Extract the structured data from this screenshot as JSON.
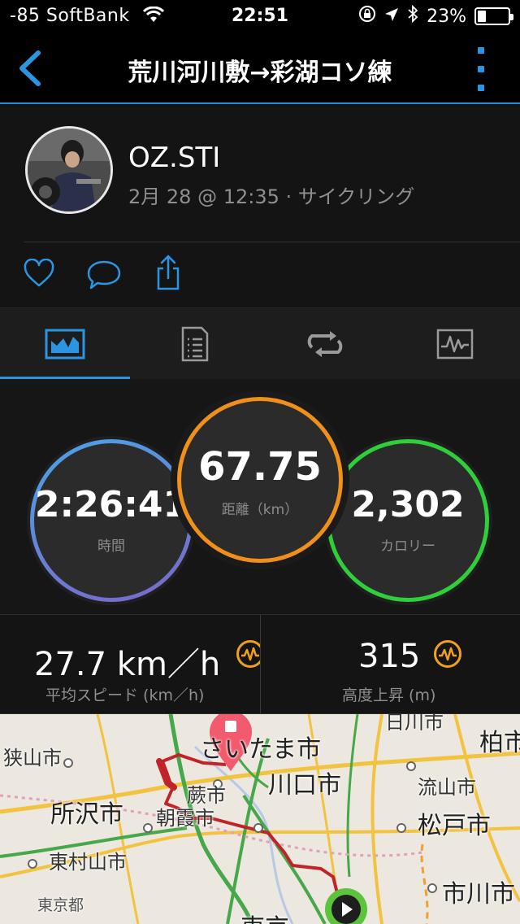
{
  "status": {
    "carrier": "-85 SoftBank",
    "time": "22:51",
    "battery": "23%"
  },
  "nav": {
    "title": "荒川河川敷→彩湖コソ練"
  },
  "profile": {
    "name": "OZ.STI",
    "meta": "2月 28 @ 12:35 · サイクリング"
  },
  "tabs": [
    {
      "icon": "overview-icon",
      "active": true
    },
    {
      "icon": "details-icon",
      "active": false
    },
    {
      "icon": "laps-icon",
      "active": false
    },
    {
      "icon": "charts-icon",
      "active": false
    }
  ],
  "stats": {
    "time": {
      "value": "2:26:41",
      "label": "時間"
    },
    "distance": {
      "value": "67.75",
      "label": "距離（km）"
    },
    "calories": {
      "value": "2,302",
      "label": "カロリー"
    }
  },
  "detail": {
    "speed": {
      "value": "27.7 km／h",
      "label": "平均スピード (km／h)"
    },
    "climb": {
      "value": "315",
      "label": "高度上昇 (m)"
    }
  },
  "map": {
    "labels": {
      "saitama": "さいたま市",
      "sayama": "狭山市",
      "tokorozawa": "所沢市",
      "warabi": "蕨市",
      "asaka": "朝霞市",
      "kawaguchi": "川口市",
      "higashimurayama": "東村山市",
      "tokyo_to": "東京都",
      "tokyo": "東京",
      "nagareyama": "流山市",
      "matsudo": "松戸市",
      "kashiwa": "柏市",
      "ichikawa": "市川市",
      "kasukabe": "日川市"
    }
  },
  "colors": {
    "accent": "#2c95e2",
    "time_ring": "#4aa3e6",
    "distance_ring": "#f0901a",
    "calories_ring": "#2fcf3a",
    "route": "#c0242a"
  }
}
